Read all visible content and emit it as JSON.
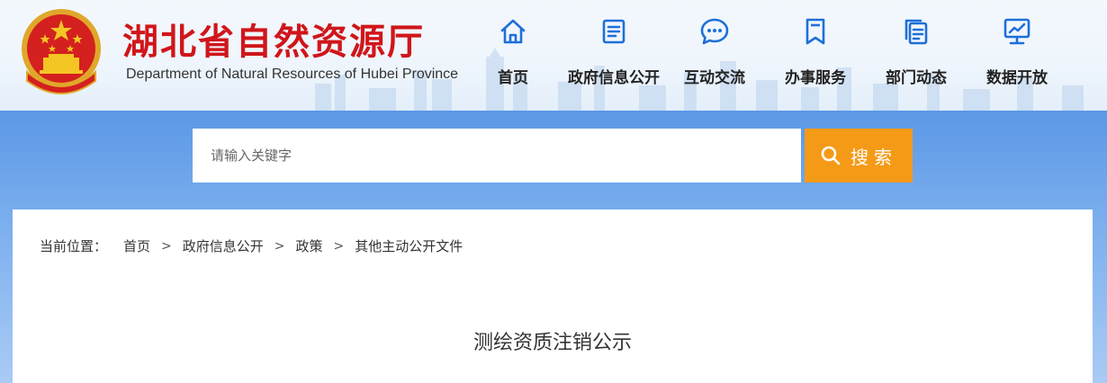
{
  "site": {
    "title": "湖北省自然资源厅",
    "subtitle": "Department of Natural Resources of Hubei Province"
  },
  "nav": {
    "items": [
      {
        "label": "首页",
        "icon": "home-icon"
      },
      {
        "label": "政府信息公开",
        "icon": "document-list-icon"
      },
      {
        "label": "互动交流",
        "icon": "chat-bubble-icon"
      },
      {
        "label": "办事服务",
        "icon": "bookmark-icon"
      },
      {
        "label": "部门动态",
        "icon": "copy-docs-icon"
      },
      {
        "label": "数据开放",
        "icon": "monitor-chart-icon"
      }
    ]
  },
  "search": {
    "placeholder": "请输入关键字",
    "button_label": "搜索",
    "accent_color": "#f59a17"
  },
  "breadcrumb": {
    "prefix": "当前位置：",
    "items": [
      "首页",
      "政府信息公开",
      "政策",
      "其他主动公开文件"
    ],
    "separator": ">"
  },
  "article": {
    "title": "测绘资质注销公示"
  },
  "colors": {
    "brand_red": "#d0161b",
    "nav_blue": "#1e6fd9",
    "band_blue": "#5c98e6"
  }
}
